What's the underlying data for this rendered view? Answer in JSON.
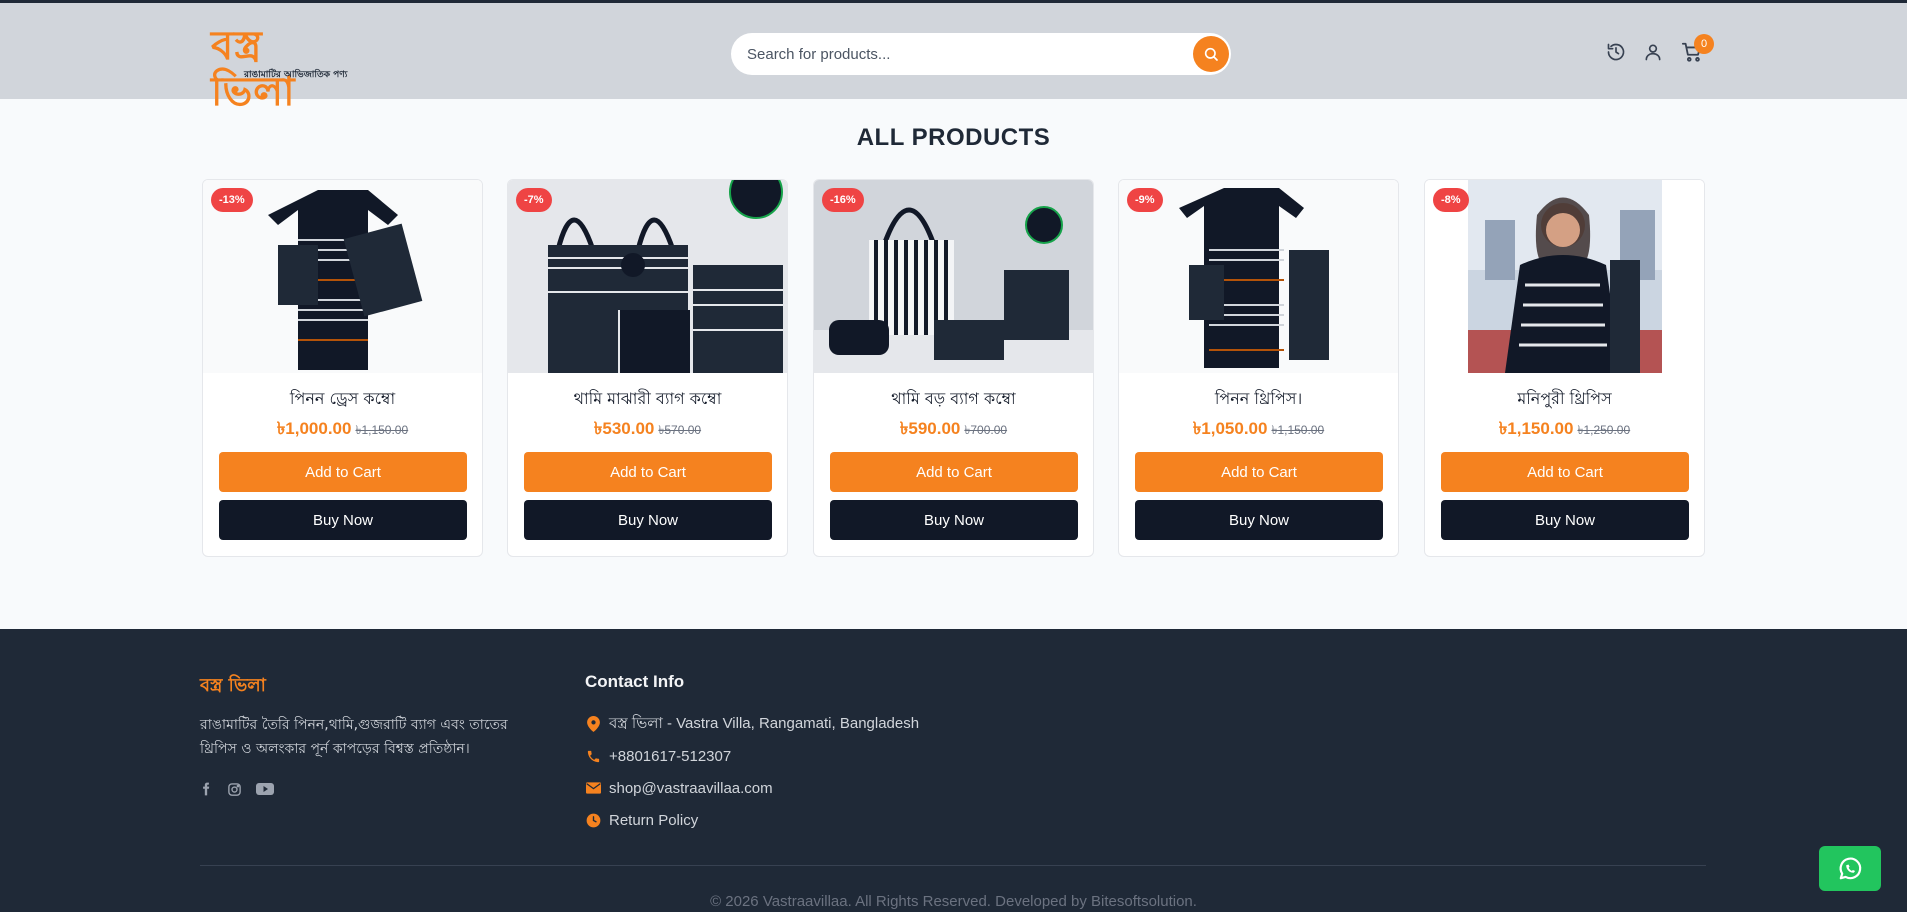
{
  "brand": {
    "logo_text": "বস্ত্র ভিলা",
    "logo_tagline": "রাঙামাটির আভিজাতিক পণ্য"
  },
  "search": {
    "placeholder": "Search for products..."
  },
  "header": {
    "cart_count": "0"
  },
  "section": {
    "title": "ALL PRODUCTS"
  },
  "products": [
    {
      "discount": "-13%",
      "name": "পিনন ড্রেস কম্বো",
      "price": "৳1,000.00",
      "old_price": "৳1,150.00",
      "add_label": "Add to Cart",
      "buy_label": "Buy Now"
    },
    {
      "discount": "-7%",
      "name": "থামি মাঝারী ব্যাগ কম্বো",
      "price": "৳530.00",
      "old_price": "৳570.00",
      "add_label": "Add to Cart",
      "buy_label": "Buy Now"
    },
    {
      "discount": "-16%",
      "name": "থামি বড় ব্যাগ কম্বো",
      "price": "৳590.00",
      "old_price": "৳700.00",
      "add_label": "Add to Cart",
      "buy_label": "Buy Now"
    },
    {
      "discount": "-9%",
      "name": "পিনন থ্রিপিস।",
      "price": "৳1,050.00",
      "old_price": "৳1,150.00",
      "add_label": "Add to Cart",
      "buy_label": "Buy Now"
    },
    {
      "discount": "-8%",
      "name": "মনিপুরী থ্রিপিস",
      "price": "৳1,150.00",
      "old_price": "৳1,250.00",
      "add_label": "Add to Cart",
      "buy_label": "Buy Now"
    }
  ],
  "footer": {
    "brand": "বস্ত্র ভিলা",
    "description": "রাঙামাটির তৈরি পিনন,থামি,গুজরাটি ব্যাগ এবং তাতের থ্রিপিস ও অলংকার পূর্ন কাপড়ের বিশ্বস্ত প্রতিষ্ঠান।",
    "contact_title": "Contact Info",
    "address": "বস্ত্র ভিলা - Vastra Villa, Rangamati, Bangladesh",
    "phone": "+8801617-512307",
    "email": "shop@vastraavillaa.com",
    "return_policy": "Return Policy",
    "copyright": "© 2026 Vastraavillaa. All Rights Reserved. Developed by Bitesoftsolution."
  },
  "colors": {
    "accent": "#f5821f",
    "dark": "#111827",
    "footer_bg": "#1f2937",
    "header_bg": "#d1d5db",
    "discount": "#ef4444",
    "whatsapp": "#22c55e"
  },
  "icons": [
    "search-icon",
    "history-icon",
    "user-icon",
    "cart-icon",
    "facebook-icon",
    "instagram-icon",
    "youtube-icon",
    "location-icon",
    "phone-icon",
    "email-icon",
    "clock-icon",
    "whatsapp-icon"
  ]
}
